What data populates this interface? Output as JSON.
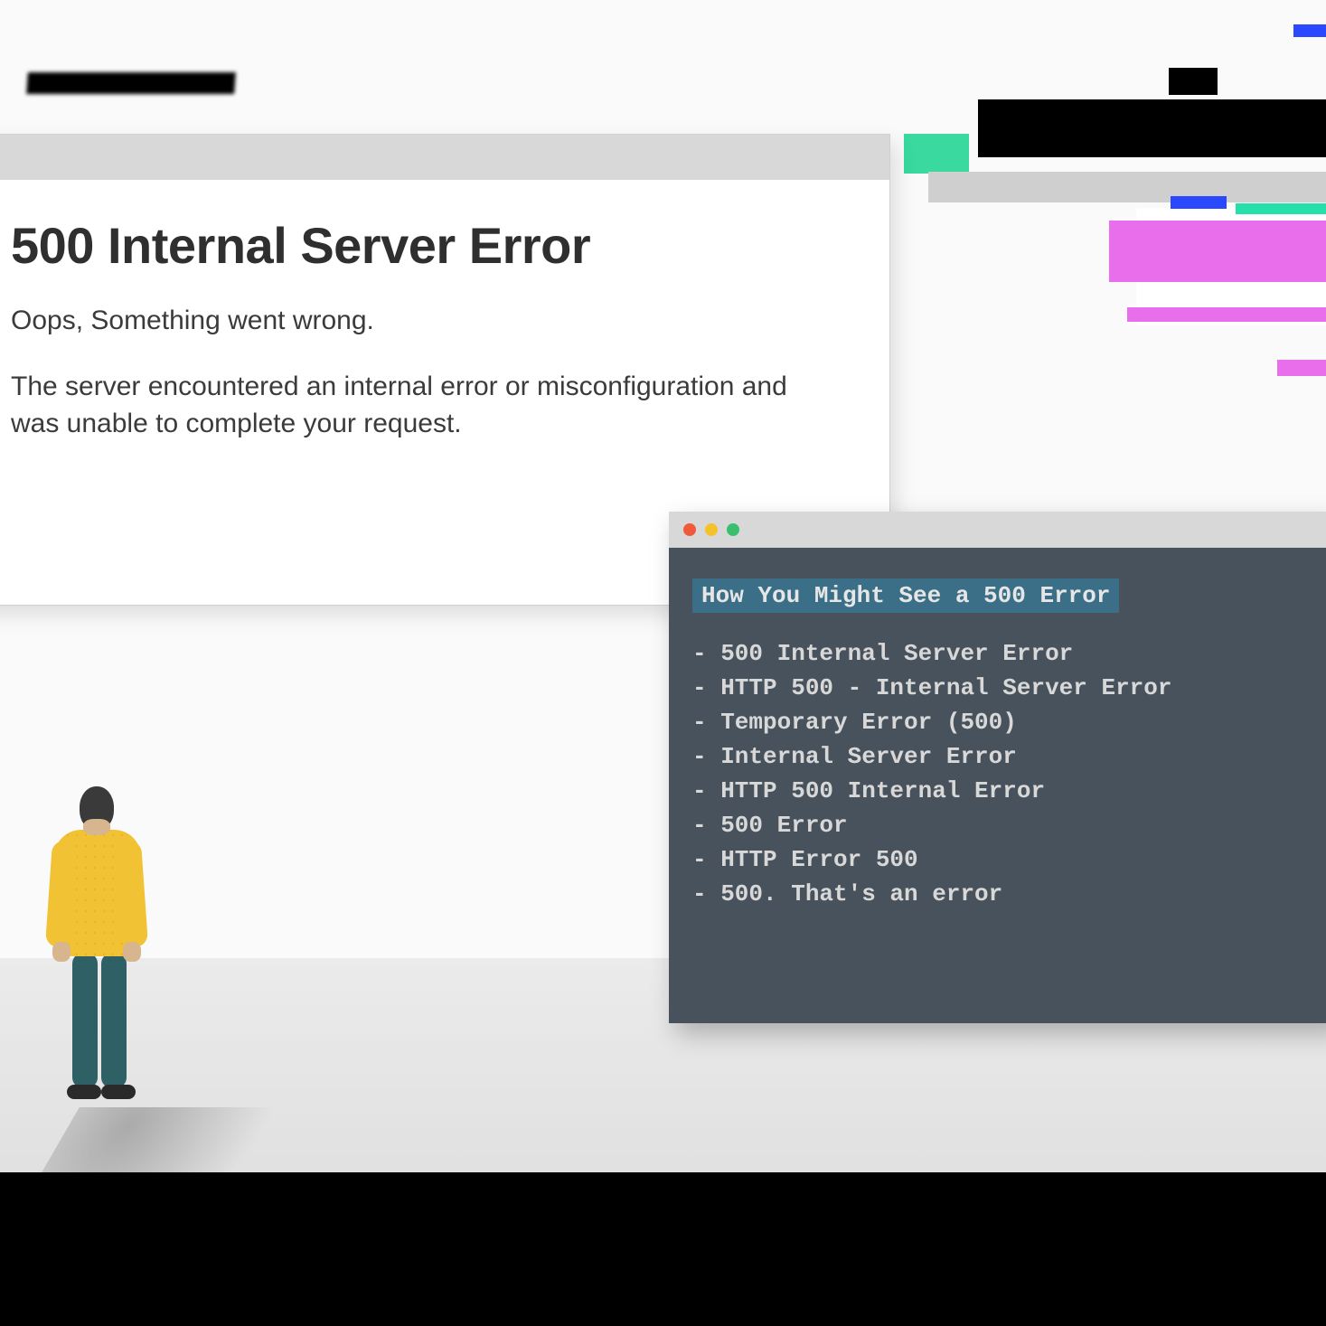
{
  "error_window": {
    "title": "500 Internal Server Error",
    "sub": "Oops, Something went wrong.",
    "desc": "The server encountered an internal error or misconfiguration and was unable to complete your request."
  },
  "terminal": {
    "heading": "How You Might See a 500 Error",
    "items": [
      "500 Internal Server Error",
      "HTTP 500 - Internal Server Error",
      "Temporary Error (500)",
      "Internal Server Error",
      "HTTP 500 Internal Error",
      "500 Error",
      "HTTP Error 500",
      "500. That's an error"
    ]
  },
  "palette": {
    "teal": "#39d9a0",
    "pink": "#e86eeb",
    "term_bg": "#48525c",
    "term_head_bg": "#3b6f87",
    "sweater": "#f1c233",
    "pants": "#2f6066"
  }
}
